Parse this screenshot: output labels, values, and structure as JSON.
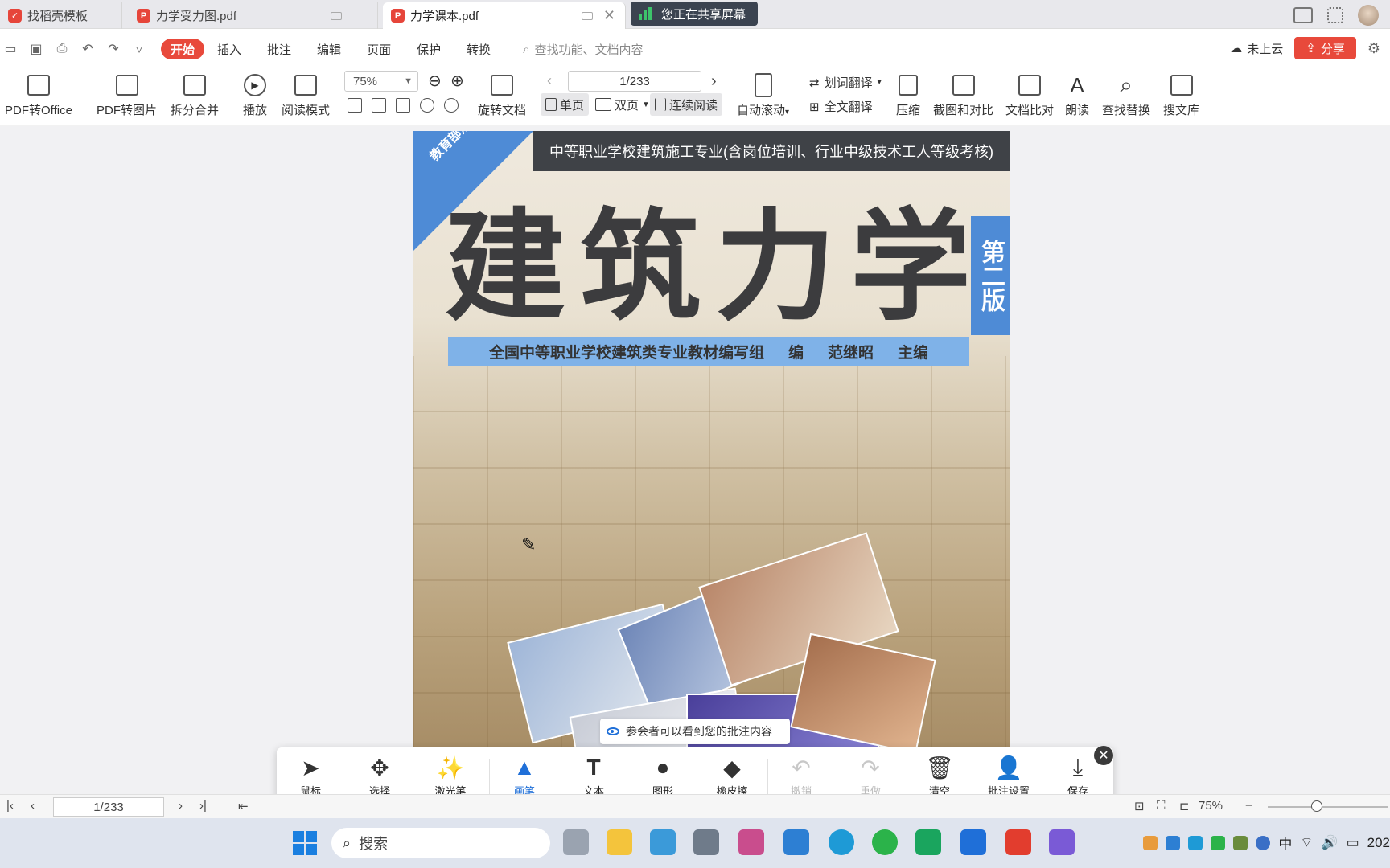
{
  "tabs": [
    {
      "label": "找稻壳模板"
    },
    {
      "label": "力学受力图.pdf"
    },
    {
      "label": "力学课本.pdf"
    }
  ],
  "share_banner": "您正在共享屏幕",
  "menu": {
    "items": [
      "开始",
      "插入",
      "批注",
      "编辑",
      "页面",
      "保护",
      "转换"
    ],
    "search_placeholder": "查找功能、文档内容",
    "cloud": "未上云",
    "share": "分享"
  },
  "ribbon": {
    "pdf_to_office": "PDF转Office",
    "pdf_to_image": "PDF转图片",
    "split_merge": "拆分合并",
    "play": "播放",
    "read_mode": "阅读模式",
    "zoom": "75%",
    "page": "1/233",
    "rotate": "旋转文档",
    "single": "单页",
    "double": "双页",
    "continuous": "连续阅读",
    "auto_scroll": "自动滚动",
    "word_translate": "划词翻译",
    "full_translate": "全文翻译",
    "compress": "压缩",
    "screenshot_compare": "截图和对比",
    "doc_compare": "文档比对",
    "read_aloud": "朗读",
    "find_replace": "查找替换",
    "search_library": "搜文库"
  },
  "document": {
    "top_band": "中等职业学校建筑施工专业(含岗位培训、行业中级技术工人等级考核)",
    "corner": "教育部规划教材",
    "title": "建筑力学",
    "edition": "第二版",
    "author_group": "全国中等职业学校建筑类专业教材编写组",
    "edit": "编",
    "editor": "范继昭",
    "chief": "主编"
  },
  "notice": "参会者可以看到您的批注内容",
  "annotation_tools": [
    {
      "label": "鼠标",
      "icon": "pointer-icon"
    },
    {
      "label": "选择",
      "icon": "move-icon"
    },
    {
      "label": "激光笔",
      "icon": "laser-icon"
    },
    {
      "label": "画笔",
      "icon": "pen-icon"
    },
    {
      "label": "文本",
      "icon": "text-icon"
    },
    {
      "label": "图形",
      "icon": "shape-icon"
    },
    {
      "label": "橡皮擦",
      "icon": "eraser-icon"
    },
    {
      "label": "撤销",
      "icon": "undo-icon"
    },
    {
      "label": "重做",
      "icon": "redo-icon"
    },
    {
      "label": "清空",
      "icon": "trash-icon"
    },
    {
      "label": "批注设置",
      "icon": "annotation-settings-icon"
    },
    {
      "label": "保存",
      "icon": "save-icon"
    }
  ],
  "status": {
    "page": "1/233",
    "zoom": "75%"
  },
  "taskbar": {
    "search": "搜索",
    "ime": "中",
    "clock": "202"
  },
  "colors": {
    "accent": "#e8493b",
    "selected_tool": "#1f6fd8"
  }
}
